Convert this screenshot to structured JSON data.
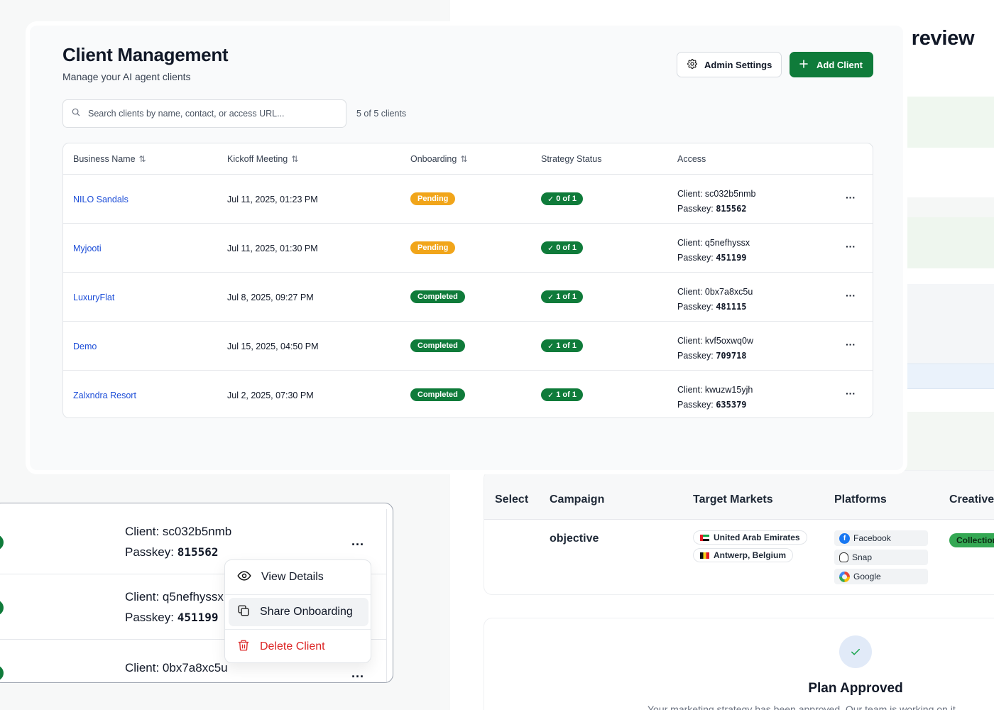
{
  "page": {
    "title": "Client Management",
    "subtitle": "Manage your AI agent clients"
  },
  "toolbar": {
    "admin_label": "Admin Settings",
    "add_label": "Add Client"
  },
  "search": {
    "placeholder": "Search clients by name, contact, or access URL...",
    "count": "5 of 5 clients"
  },
  "table": {
    "headers": {
      "business": "Business Name",
      "kickoff": "Kickoff Meeting",
      "onboarding": "Onboarding",
      "strategy": "Strategy Status",
      "access": "Access"
    },
    "rows": [
      {
        "name": "NILO Sandals",
        "date": "Jul 11, 2025, 01:23 PM",
        "onboarding": "Pending",
        "strategy": "0 of 1",
        "client_label": "Client: ",
        "client": "sc032b5nmb",
        "passkey_label": "Passkey: ",
        "passkey": "815562"
      },
      {
        "name": "Myjooti",
        "date": "Jul 11, 2025, 01:30 PM",
        "onboarding": "Pending",
        "strategy": "0 of 1",
        "client_label": "Client: ",
        "client": "q5nefhyssx",
        "passkey_label": "Passkey: ",
        "passkey": "451199"
      },
      {
        "name": "LuxuryFlat",
        "date": "Jul 8, 2025, 09:27 PM",
        "onboarding": "Completed",
        "strategy": "1 of 1",
        "client_label": "Client: ",
        "client": "0bx7a8xc5u",
        "passkey_label": "Passkey: ",
        "passkey": "481115"
      },
      {
        "name": "Demo",
        "date": "Jul 15, 2025, 04:50 PM",
        "onboarding": "Completed",
        "strategy": "1 of 1",
        "client_label": "Client: ",
        "client": "kvf5oxwq0w",
        "passkey_label": "Passkey: ",
        "passkey": "709718"
      },
      {
        "name": "Zalxndra Resort",
        "date": "Jul 2, 2025, 07:30 PM",
        "onboarding": "Completed",
        "strategy": "1 of 1",
        "client_label": "Client: ",
        "client": "kwuzw15yjh",
        "passkey_label": "Passkey: ",
        "passkey": "635379"
      }
    ],
    "more_glyph": "···"
  },
  "zoom": {
    "rows": [
      {
        "client_label": "Client: ",
        "client": "sc032b5nmb",
        "passkey_label": "Passkey: ",
        "passkey": "815562"
      },
      {
        "client_label": "Client: ",
        "client": "q5nefhyssx",
        "passkey_label": "Passkey: ",
        "passkey": "451199"
      },
      {
        "client_label": "Client: ",
        "client": "0bx7a8xc5u"
      }
    ],
    "menu": {
      "view": "View Details",
      "share": "Share Onboarding",
      "delete": "Delete Client"
    }
  },
  "review": {
    "title_fragment": "r review",
    "headers": {
      "select": "Select",
      "campaign": "Campaign",
      "markets": "Target Markets",
      "platforms": "Platforms",
      "creative": "Creative"
    },
    "row": {
      "campaign": "objective",
      "markets": [
        "United Arab Emirates",
        "Antwerp, Belgium"
      ],
      "platforms": [
        "Facebook",
        "Snap",
        "Google"
      ],
      "creative": "Collection"
    },
    "approved_title": "Plan Approved",
    "approved_sub": "Your marketing strategy has been approved. Our team is working on it."
  },
  "colors": {
    "primary_green": "#0f7b3a",
    "pending_amber": "#f1a51a",
    "link_blue": "#1d4ed8",
    "danger_red": "#dc2626"
  }
}
